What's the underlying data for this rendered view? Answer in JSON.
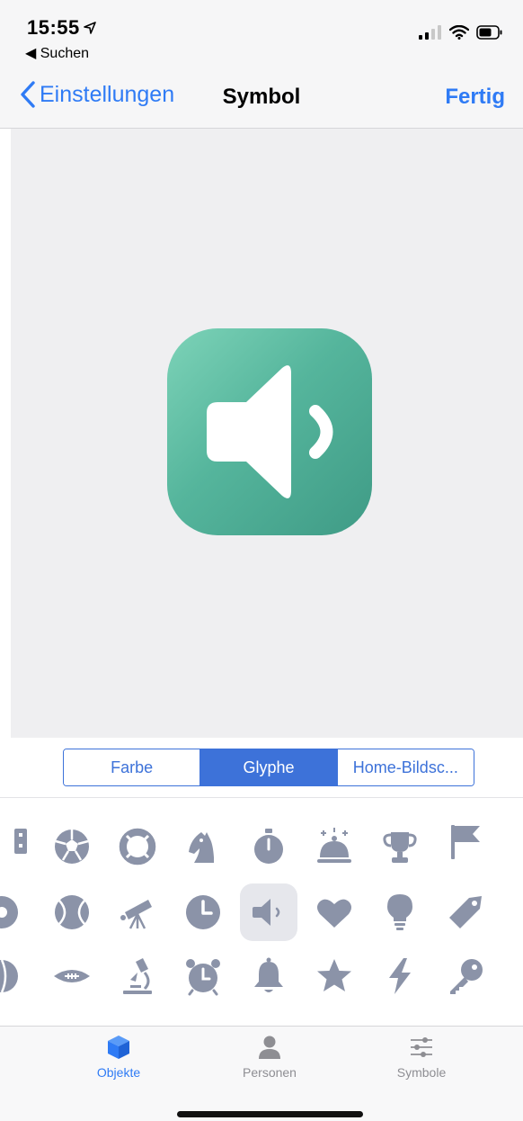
{
  "status_bar": {
    "time": "15:55",
    "back_app": "◀ Suchen"
  },
  "nav": {
    "back_label": "Einstellungen",
    "title": "Symbol",
    "done_label": "Fertig"
  },
  "preview": {
    "glyph": "speaker-icon",
    "gradient_colors": [
      "#7dd3b8",
      "#3f9b86"
    ]
  },
  "segments": [
    "Farbe",
    "Glyphe",
    "Home-Bildsc..."
  ],
  "selected_segment": "Glyphe",
  "glyph_rows": [
    [
      "partial-icon",
      "soccer-ball-icon",
      "lifebuoy-icon",
      "chess-knight-icon",
      "stopwatch-icon",
      "room-service-icon",
      "trophy-icon",
      "flag-icon",
      "partial-icon"
    ],
    [
      "partial-icon",
      "tennis-ball-icon",
      "telescope-icon",
      "clock-icon",
      "speaker-icon",
      "heart-icon",
      "lightbulb-icon",
      "tag-icon",
      "partial-icon"
    ],
    [
      "partial-icon",
      "football-icon",
      "microscope-icon",
      "alarm-clock-icon",
      "bell-icon",
      "star-icon",
      "lightning-icon",
      "key-icon",
      "partial-icon"
    ]
  ],
  "selected_glyph": "speaker-icon",
  "tabs": [
    {
      "label": "Objekte",
      "icon": "cube-icon",
      "active": true
    },
    {
      "label": "Personen",
      "icon": "person-icon",
      "active": false
    },
    {
      "label": "Symbole",
      "icon": "sliders-icon",
      "active": false
    }
  ],
  "colors": {
    "accent": "#2f7bf5",
    "segment_blue": "#3d72d9",
    "glyph_gray": "#8b93a8",
    "icon_green": "#55b59c"
  }
}
